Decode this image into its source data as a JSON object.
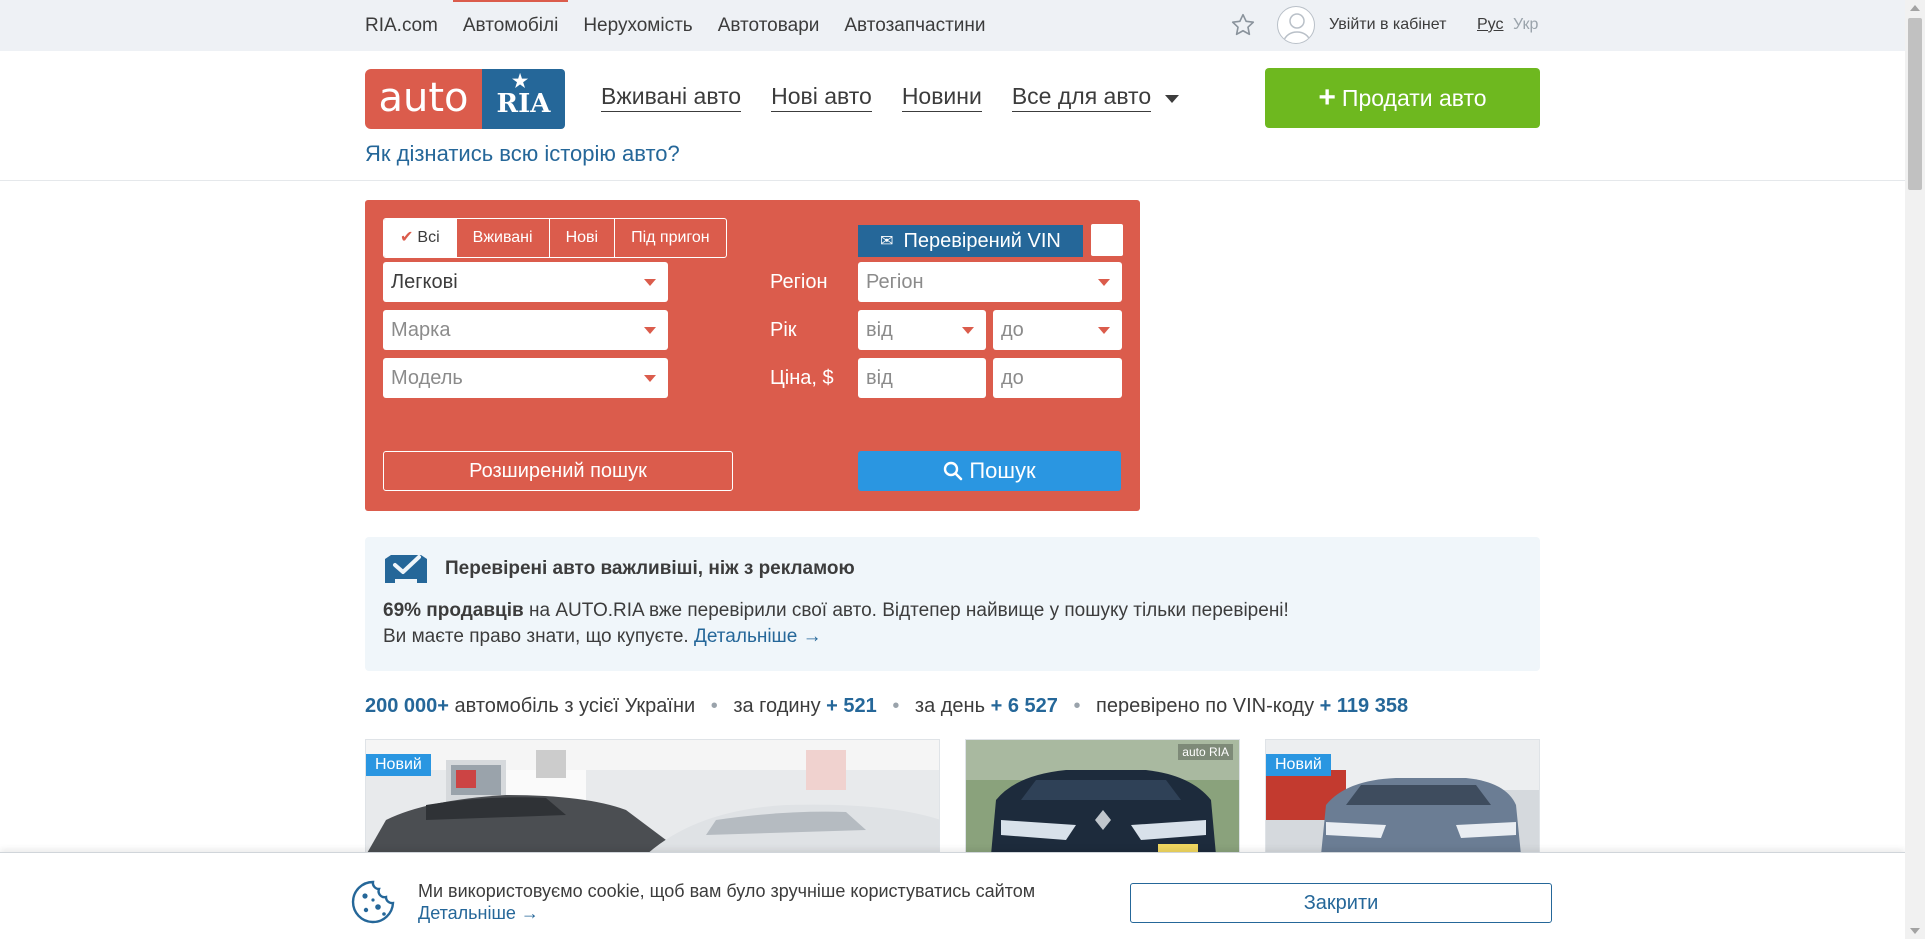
{
  "topbar": {
    "nav": [
      "RIA.com",
      "Автомобілі",
      "Нерухомість",
      "Автотовари",
      "Автозапчастини"
    ],
    "login": "Увійти в кабінет",
    "lang_ru": "Рус",
    "lang_ua": "Укр"
  },
  "header": {
    "logo_auto": "auto",
    "logo_ria": "RIA",
    "nav": {
      "used": "Вживані авто",
      "new": "Нові авто",
      "news": "Новини",
      "all": "Все для авто"
    },
    "sell_label": "Продати авто",
    "history_link": "Як дізнатись всю історію авто?"
  },
  "search": {
    "segments": [
      "Всі",
      "Вживані",
      "Нові",
      "Під пригон"
    ],
    "vin_label": "Перевірений VIN",
    "type_value": "Легкові",
    "brand_placeholder": "Марка",
    "model_placeholder": "Модель",
    "region_label": "Регіон",
    "region_placeholder": "Регіон",
    "year_label": "Рік",
    "year_from": "від",
    "year_to": "до",
    "price_label": "Ціна, $",
    "price_from": "від",
    "price_to": "до",
    "extended_label": "Розширений пошук",
    "search_label": "Пошук"
  },
  "banner": {
    "title": "Перевірені авто важливіші, ніж з рекламою",
    "bold": "69% продавців",
    "line1_rest": " на AUTO.RIA вже перевірили свої авто. Відтепер найвище у пошуку тільки перевірені!",
    "line2": "Ви маєте право знати, що купуєте. ",
    "link": "Детальніше →"
  },
  "stats": {
    "total": "200 000+",
    "total_text": " автомобіль з усієї України",
    "hour_text": "за годину",
    "hour_value": "+ 521",
    "day_text": "за день",
    "day_value": "+ 6 527",
    "vin_text": "перевірено по VIN-коду",
    "vin_value": "+ 119 358"
  },
  "cards": {
    "badge_new": "Новий",
    "watermark": "auto RIA"
  },
  "cookie": {
    "text": "Ми використовуємо cookie, щоб вам було зручніше користуватись сайтом",
    "link": "Детальніше →",
    "close": "Закрити"
  },
  "colors": {
    "brand_red": "#db5c4c",
    "brand_blue": "#256799",
    "sell_green": "#6eb81f",
    "search_blue": "#2a96e1"
  }
}
